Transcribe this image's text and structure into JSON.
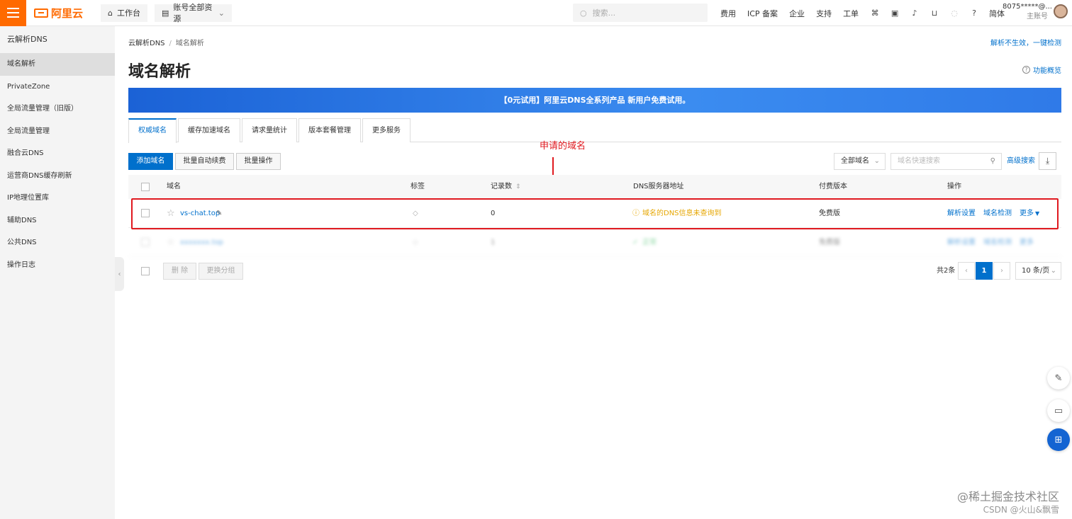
{
  "topbar": {
    "logo_text": "阿里云",
    "workbench": "工作台",
    "resource_scope": "账号全部资源",
    "search_placeholder": "搜索...",
    "links": [
      "费用",
      "ICP 备案",
      "企业",
      "支持",
      "工单"
    ],
    "lang": "简体",
    "account": "8075*****@...",
    "account_sub": "主账号"
  },
  "sidebar": {
    "title": "云解析DNS",
    "items": [
      "域名解析",
      "PrivateZone",
      "全局流量管理（旧版）",
      "全局流量管理",
      "融合云DNS",
      "运营商DNS缓存刷新",
      "IP地理位置库",
      "辅助DNS",
      "公共DNS",
      "操作日志"
    ],
    "active_index": 0
  },
  "breadcrumb": {
    "root": "云解析DNS",
    "separator": "/",
    "current": "域名解析"
  },
  "page_title": "域名解析",
  "top_link": "解析不生效，一键检测",
  "help_link": "功能概览",
  "banner": "【0元试用】阿里云DNS全系列产品 新用户免费试用。",
  "tabs": [
    "权威域名",
    "缓存加速域名",
    "请求量统计",
    "版本套餐管理",
    "更多服务"
  ],
  "toolbar": {
    "add_domain": "添加域名",
    "batch_renew": "批量自动续费",
    "batch_ops": "批量操作",
    "filter_select": "全部域名",
    "search_placeholder": "域名快速搜索",
    "advanced_search": "高级搜索"
  },
  "annotation": {
    "label": "申请的域名",
    "color": "#e0191f"
  },
  "table": {
    "headers": {
      "domain": "域名",
      "tag": "标签",
      "records": "记录数",
      "dns": "DNS服务器地址",
      "edition": "付费版本",
      "actions": "操作"
    },
    "rows": [
      {
        "domain": "vs-chat.top",
        "records": "0",
        "dns_status": "域名的DNS信息未查询到",
        "edition": "免费版",
        "action1": "解析设置",
        "action2": "域名检测",
        "action3": "更多"
      },
      {
        "domain": "xxxxxxx.top",
        "records": "1",
        "dns_status": "正常",
        "edition": "免费版",
        "action1": "解析设置",
        "action2": "域名检测",
        "action3": "更多"
      }
    ]
  },
  "footer": {
    "delete": "删 除",
    "change_group": "更换分组",
    "total": "共2条",
    "current_page": "1",
    "page_size": "10 条/页"
  },
  "watermark": {
    "line1": "@稀土掘金技术社区",
    "line2": "CSDN @火山&飘雪"
  },
  "colors": {
    "accent": "#0070cc",
    "brand": "#ff6a00",
    "warning": "#e6a600",
    "annotation": "#e0191f"
  }
}
